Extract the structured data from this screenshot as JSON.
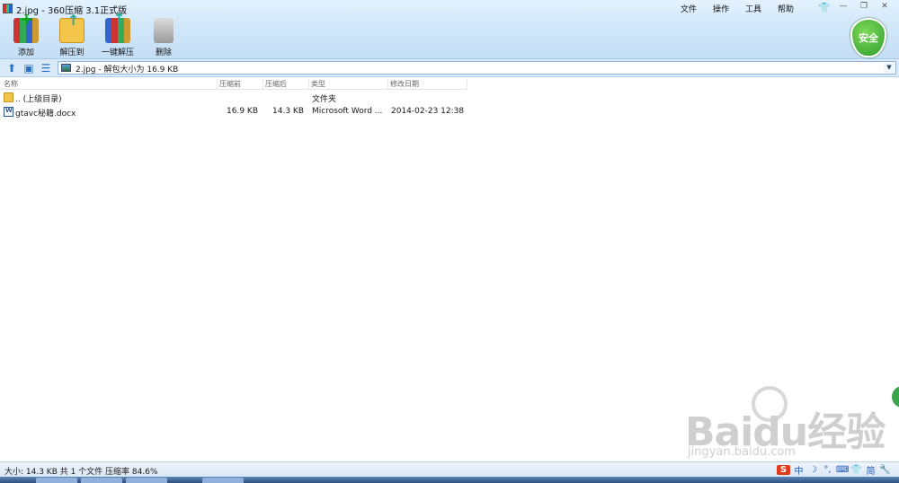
{
  "window": {
    "title": "2.jpg - 360压缩 3.1正式版"
  },
  "menu": [
    "文件",
    "操作",
    "工具",
    "帮助"
  ],
  "toolbar": {
    "add": "添加",
    "extract_to": "解压到",
    "one_click_extract": "一键解压",
    "delete": "删除"
  },
  "safe_badge": "安全",
  "path": {
    "text": "2.jpg - 解包大小为 16.9 KB"
  },
  "columns": {
    "name": "名称",
    "before": "压缩前",
    "after": "压缩后",
    "type": "类型",
    "date": "修改日期"
  },
  "rows": [
    {
      "icon": "folder-icon",
      "name": ".. (上级目录)",
      "before": "",
      "after": "",
      "type": "文件夹",
      "date": ""
    },
    {
      "icon": "word-doc-icon",
      "name": "gtavc秘籍.docx",
      "before": "16.9 KB",
      "after": "14.3 KB",
      "type": "Microsoft Word ...",
      "date": "2014-02-23 12:38"
    }
  ],
  "status": {
    "text": "大小: 14.3 KB 共 1 个文件 压缩率 84.6%"
  },
  "tray": [
    "S",
    "中",
    "☽",
    "°,",
    "⌨",
    "👕",
    "简",
    "🔧"
  ],
  "watermark": {
    "logo": "Baidu经验",
    "sub": "jingyan.baidu.com"
  },
  "colors": {
    "toolbar_bg": "#d3e8fa",
    "safe_green": "#2e9d2e"
  }
}
